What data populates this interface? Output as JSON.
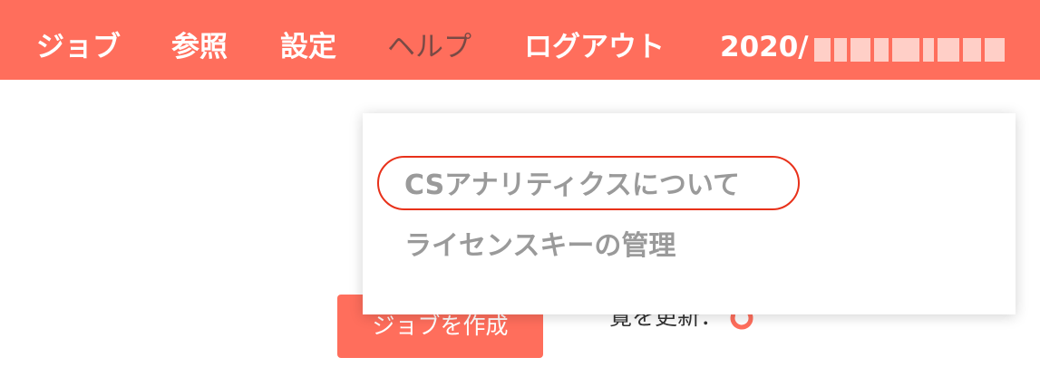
{
  "accent_color": "#ff6e5c",
  "nav": {
    "items": [
      {
        "label": "ジョブ"
      },
      {
        "label": "参照"
      },
      {
        "label": "設定"
      },
      {
        "label": "ヘルプ"
      },
      {
        "label": "ログアウト"
      }
    ],
    "datetime_prefix": "2020/"
  },
  "help_menu": {
    "items": [
      {
        "label": "CSアナリティクスについて"
      },
      {
        "label": "ライセンスキーの管理"
      }
    ]
  },
  "main": {
    "create_job_label": "ジョブを作成",
    "refresh_label": "覧を更新："
  }
}
